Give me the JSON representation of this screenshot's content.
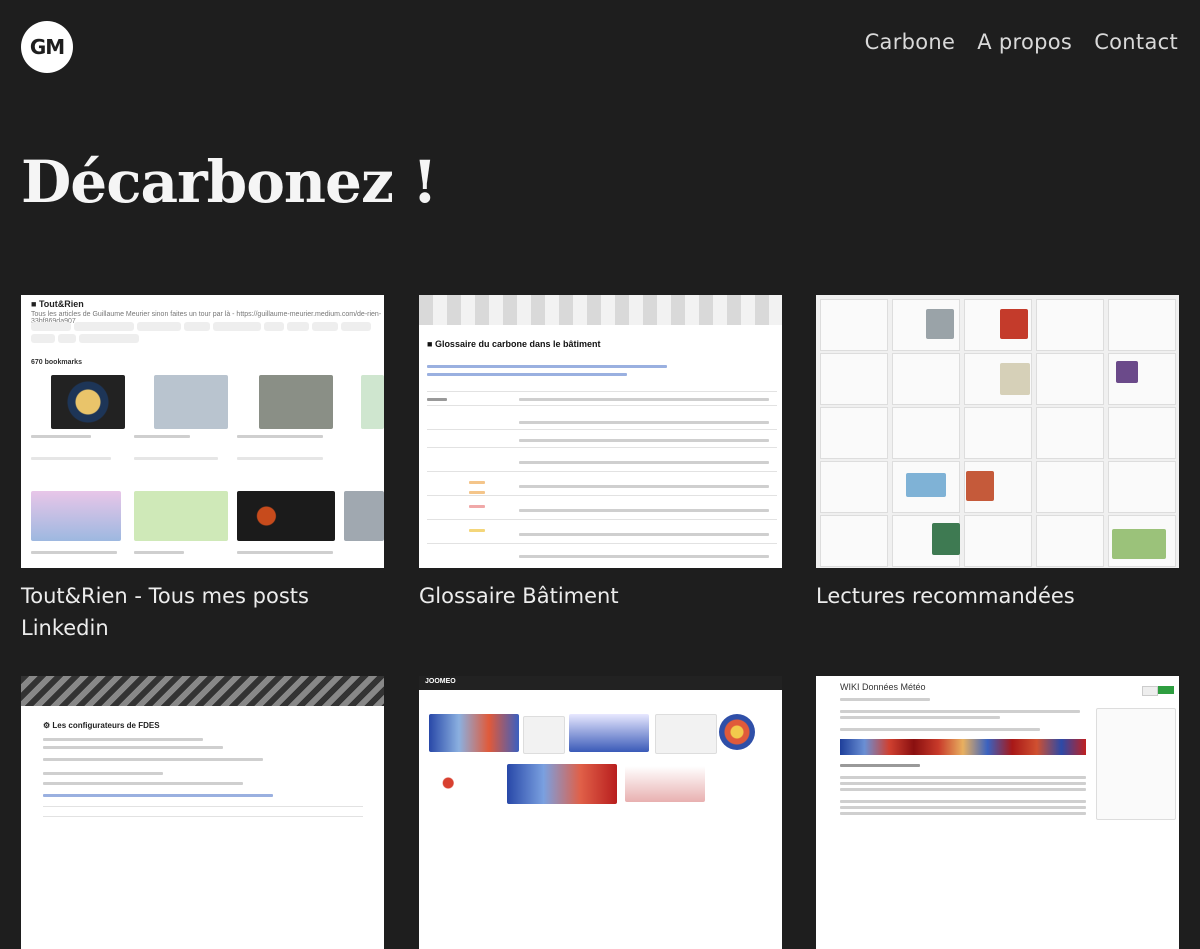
{
  "header": {
    "logo_text": "GM",
    "nav": [
      "Carbone",
      "A propos",
      "Contact"
    ]
  },
  "hero": {
    "title": "Décarbonez !"
  },
  "cards": [
    {
      "caption": "Tout&Rien - Tous mes posts Linkedin",
      "thumb_title": "Tout&Rien",
      "thumb_subtitle": "Tous les articles de Guillaume Meurier sinon faites un tour par là - https://guillaume-meurier.medium.com/de-rien-33bf869da907",
      "thumb_count": "670 bookmarks"
    },
    {
      "caption": "Glossaire Bâtiment",
      "thumb_title": "Glossaire du carbone dans le bâtiment"
    },
    {
      "caption": "Lectures recommandées"
    },
    {
      "thumb_title": "Les configurateurs de FDES"
    },
    {
      "thumb_brand": "JOOMEO"
    },
    {
      "thumb_title": "WIKI Données Météo"
    }
  ],
  "colors": {
    "background": "#1e1e1e",
    "text": "#ececec",
    "logo_bg": "#ffffff"
  }
}
